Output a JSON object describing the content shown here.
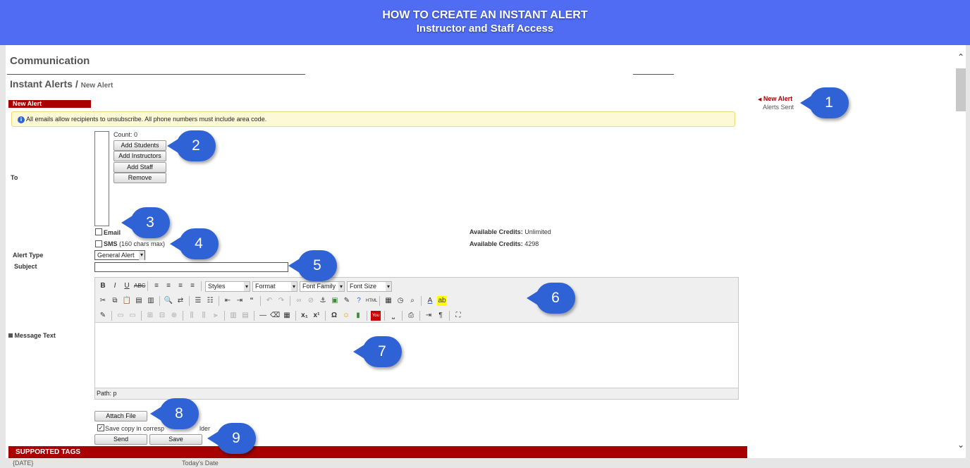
{
  "banner": {
    "title": "HOW TO CREATE AN INSTANT ALERT",
    "subtitle": "Instructor and Staff Access"
  },
  "page": {
    "section_title": "Communication",
    "breadcrumb_main": "Instant Alerts",
    "breadcrumb_sep": "/",
    "breadcrumb_current": "New Alert"
  },
  "form_header": "New Alert",
  "info_notice": "All emails allow recipients to unsubscribe. All phone numbers must include area code.",
  "to_section": {
    "label": "To",
    "count": "Count: 0",
    "buttons": [
      "Add Students",
      "Add Instructors",
      "Add Staff",
      "Remove"
    ]
  },
  "email": {
    "label": "Email",
    "checked": false
  },
  "sms": {
    "label": "SMS",
    "note": "(160 chars max)",
    "checked": false
  },
  "credits": [
    {
      "label": "Available Credits:",
      "value": "Unlimited"
    },
    {
      "label": "Available Credits:",
      "value": "4298"
    }
  ],
  "alert_type": {
    "label": "Alert Type",
    "value": "General Alert"
  },
  "subject": {
    "label": "Subject",
    "value": ""
  },
  "editor": {
    "dropdowns": [
      "Styles",
      "Format",
      "Font Family",
      "Font Size"
    ],
    "message_label": "Message Text",
    "path": "Path: p",
    "toolbar_icons": [
      "bold-icon",
      "italic-icon",
      "underline-icon",
      "strikethrough-icon",
      "align-left-icon",
      "align-center-icon",
      "align-right-icon",
      "justify-icon",
      "cut-icon",
      "copy-icon",
      "paste-icon",
      "find-icon",
      "bullet-list-icon",
      "numbered-list-icon",
      "undo-icon",
      "redo-icon",
      "link-icon",
      "anchor-icon",
      "image-icon",
      "help-icon",
      "html-icon",
      "font-color-icon",
      "highlight-icon",
      "table-icon",
      "horizontal-rule-icon",
      "subscript-icon",
      "superscript-icon",
      "special-char-icon",
      "emoticon-icon",
      "media-icon",
      "youtube-icon",
      "print-icon"
    ]
  },
  "attach_label": "Attach File",
  "save_copy": {
    "label": "Save copy in corresp",
    "label_tail": "lder",
    "checked": true
  },
  "actions": {
    "send": "Send",
    "save": "Save"
  },
  "supported_tags": {
    "header": "SUPPORTED TAGS",
    "first_tag": "{DATE}",
    "first_desc": "Today's Date"
  },
  "side_nav": {
    "items": [
      "New Alert",
      "Alerts Sent"
    ]
  },
  "callouts": [
    "1",
    "2",
    "3",
    "4",
    "5",
    "6",
    "7",
    "8",
    "9"
  ],
  "colors": {
    "banner": "#4f6cf2",
    "header_bar": "#a80000",
    "callout": "#2f62d4",
    "notice_bg": "#fdf8d5"
  }
}
